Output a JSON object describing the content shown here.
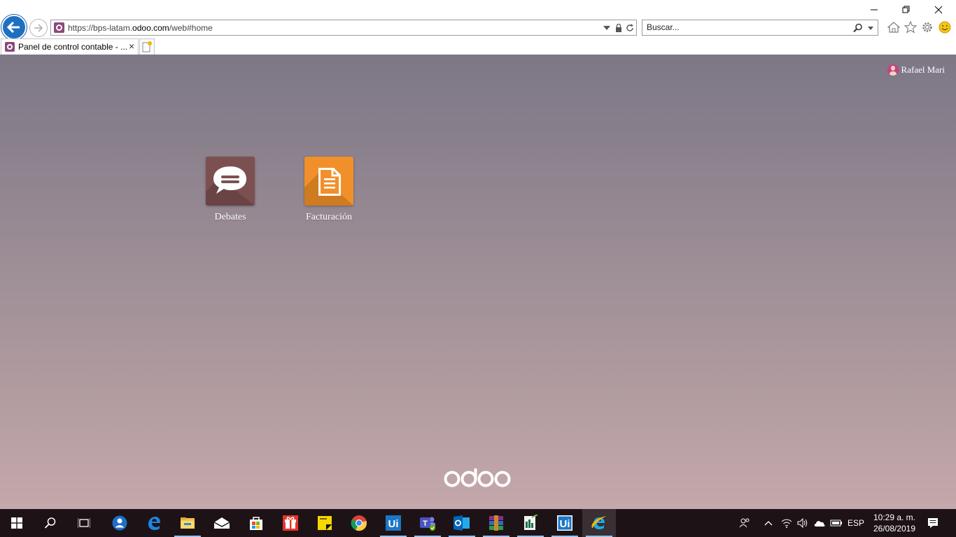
{
  "browser": {
    "url_prefix": "https://bps-latam.",
    "url_domain": "odoo.com",
    "url_suffix": "/web#home",
    "search_placeholder": "Buscar...",
    "tab_title": "Panel de control contable - ...",
    "tab_close": "×"
  },
  "odoo": {
    "user_name": "Rafael Mari",
    "apps": [
      {
        "label": "Debates",
        "color": "#7c5051",
        "icon": "chat-bubble-icon"
      },
      {
        "label": "Facturación",
        "color": "#f1902a",
        "icon": "document-icon"
      }
    ],
    "logo_text": "odoo"
  },
  "taskbar": {
    "language": "ESP",
    "time": "10:29 a. m.",
    "date": "26/08/2019",
    "apps": [
      "start-icon",
      "search-icon",
      "task-view-icon",
      "people-app-icon",
      "edge-icon",
      "file-explorer-icon",
      "mail-icon",
      "store-icon",
      "gift-app-icon",
      "sticky-notes-icon",
      "chrome-icon",
      "uipath-studio-icon",
      "teams-icon",
      "outlook-icon",
      "winrar-icon",
      "excel-icon",
      "uipath-robot-icon",
      "internet-explorer-icon"
    ]
  },
  "colors": {
    "accent": "#1f6fc1",
    "odoo_brand": "#8b4a7b",
    "debates": "#7c5051",
    "facturacion": "#f1902a"
  }
}
